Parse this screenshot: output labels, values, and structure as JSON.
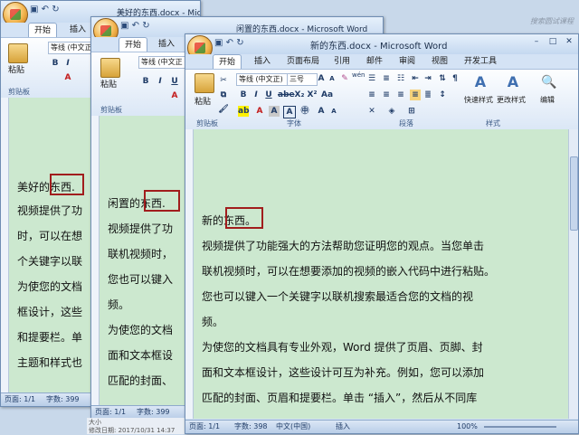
{
  "search_hint": "搜索圆试课程",
  "window1": {
    "title": "美好的东西.docx - Microsoft Word",
    "tabs": [
      "开始",
      "插入"
    ],
    "font_name": "等线 (中文正",
    "clipboard_label": "剪贴板",
    "paste_label": "粘贴",
    "lines": [
      "美好的东西.",
      "视频提供了功",
      "时，可以在想",
      "个关键字以联",
      "为使您的文档",
      "框设计，这些",
      "和提要栏。单",
      "主题和样式也"
    ],
    "status": {
      "page": "页面: 1/1",
      "words": "字数: 399"
    }
  },
  "window2": {
    "title": "闲置的东西.docx - Microsoft Word",
    "tabs": [
      "开始",
      "插入"
    ],
    "font_name": "等线 (中文正",
    "clipboard_label": "剪贴板",
    "paste_label": "粘贴",
    "lines": [
      "闲置的东西.",
      "视频提供了功",
      "联机视频时，",
      "您也可以键入",
      "频。",
      "为使您的文档",
      "面和文本框设",
      "匹配的封面、"
    ],
    "status": {
      "page": "页面: 1/1",
      "words": "字数: 399"
    },
    "file_info": {
      "size_label": "大小",
      "modified": "修改日期: 2017/10/31 14:37"
    }
  },
  "window3": {
    "title": "新的东西.docx - Microsoft Word",
    "tabs": [
      "开始",
      "插入",
      "页面布局",
      "引用",
      "邮件",
      "审阅",
      "视图",
      "开发工具"
    ],
    "font_name": "等线 (中文正)",
    "font_size": "三号",
    "wen": "wén",
    "groups": {
      "clipboard": "剪贴板",
      "font": "字体",
      "paragraph": "段落",
      "styles": "样式"
    },
    "paste_label": "粘贴",
    "quick_styles": "快速样式",
    "change_styles": "更改样式",
    "editing": "编辑",
    "lines": [
      "新的东西。",
      "视频提供了功能强大的方法帮助您证明您的观点。当您单击",
      "联机视频时，可以在想要添加的视频的嵌入代码中进行粘贴。",
      "您也可以键入一个关键字以联机搜索最适合您的文档的视",
      "频。",
      "为使您的文档具有专业外观，Word 提供了页眉、页脚、封",
      "面和文本框设计，这些设计可互为补充。例如，您可以添加",
      "匹配的封面、页眉和提要栏。单击 “插入”，然后从不同库"
    ],
    "status": {
      "page": "页面: 1/1",
      "words": "字数: 398",
      "lang": "中文(中国)",
      "mode": "插入",
      "zoom": "100%"
    }
  }
}
